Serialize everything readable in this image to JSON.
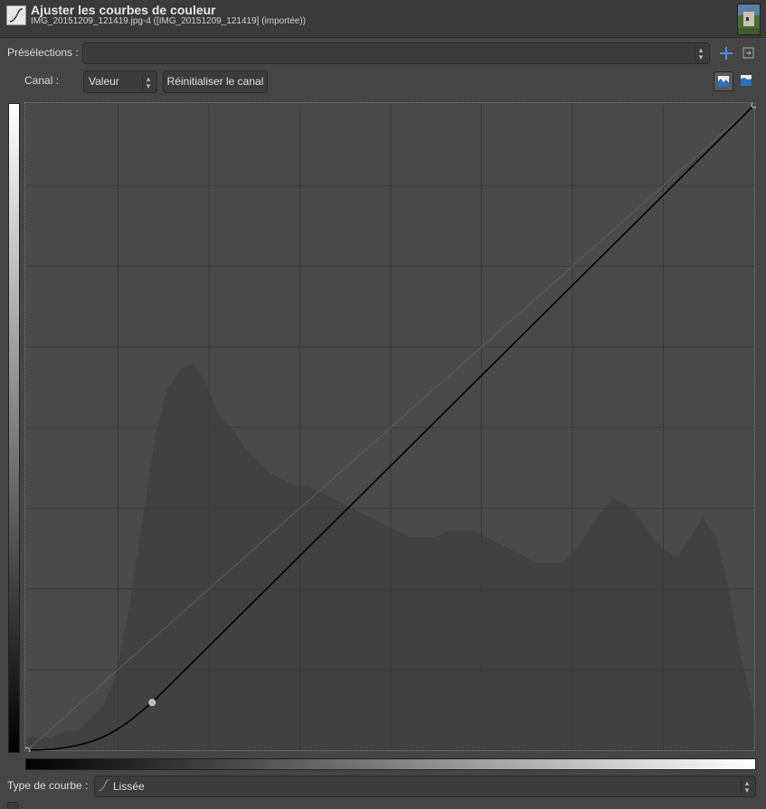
{
  "window": {
    "title": "Ajuster les courbes de couleur",
    "subtitle": "IMG_20151209_121419.jpg-4 ([IMG_20151209_121419] (importée))"
  },
  "presets": {
    "label": "Présélections :",
    "value": "",
    "add_icon": "plus-icon",
    "menu_icon": "menu-arrow-icon"
  },
  "channel": {
    "label": "Canal :",
    "value": "Valeur",
    "reset_label": "Réinitialiser le canal",
    "linear_histogram_icon": "linear-histogram-icon",
    "log_histogram_icon": "logarithmic-histogram-icon"
  },
  "curve_type": {
    "label": "Type de courbe :",
    "value": "Lissée",
    "icon": "smooth-curve-icon"
  },
  "curve": {
    "control_points": [
      [
        0,
        0
      ],
      [
        0.172,
        0.074
      ],
      [
        1,
        1
      ]
    ],
    "histogram": [
      0.02,
      0.02,
      0.02,
      0.03,
      0.03,
      0.05,
      0.07,
      0.12,
      0.22,
      0.35,
      0.48,
      0.56,
      0.59,
      0.6,
      0.57,
      0.52,
      0.5,
      0.47,
      0.45,
      0.43,
      0.42,
      0.41,
      0.41,
      0.4,
      0.39,
      0.38,
      0.37,
      0.36,
      0.35,
      0.34,
      0.33,
      0.33,
      0.33,
      0.34,
      0.34,
      0.34,
      0.33,
      0.32,
      0.31,
      0.3,
      0.29,
      0.29,
      0.29,
      0.31,
      0.34,
      0.37,
      0.39,
      0.38,
      0.36,
      0.33,
      0.31,
      0.3,
      0.33,
      0.36,
      0.33,
      0.25,
      0.14,
      0.06
    ]
  },
  "colors": {
    "background": "#454545",
    "graph_background": "#4a4a4a",
    "grid": "#3a3a3a",
    "histogram": "#414141",
    "curve": "#000000",
    "accent": "#4a90e2"
  }
}
